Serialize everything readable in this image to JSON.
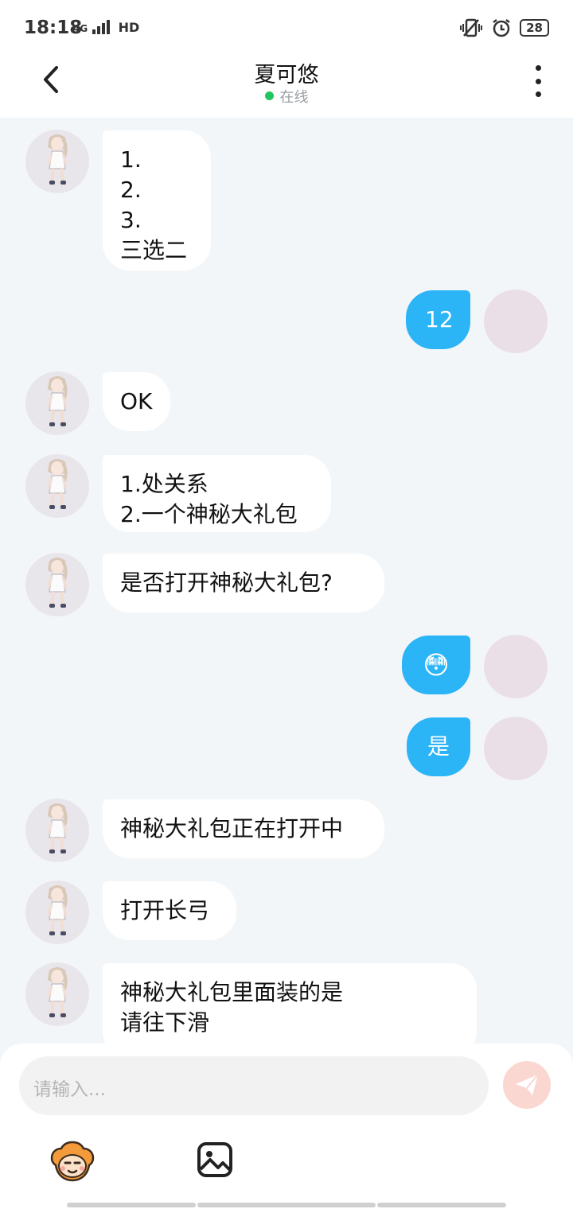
{
  "status_bar": {
    "time": "18:18",
    "network": "4G",
    "hd": "HD",
    "battery": "28"
  },
  "header": {
    "title": "夏可悠",
    "presence": "在线"
  },
  "messages": [
    {
      "side": "in",
      "text": "1.\n2.\n3.\n三选二"
    },
    {
      "side": "out",
      "text": "12"
    },
    {
      "side": "in",
      "text": "OK"
    },
    {
      "side": "in",
      "text": "1.处关系\n2.一个神秘大礼包"
    },
    {
      "side": "in",
      "text": "是否打开神秘大礼包?"
    },
    {
      "side": "out",
      "text": "😳"
    },
    {
      "side": "out",
      "text": "是"
    },
    {
      "side": "in",
      "text": "神秘大礼包正在打开中"
    },
    {
      "side": "in",
      "text": "打开长弓"
    },
    {
      "side": "in",
      "text": "神秘大礼包里面装的是\n请往下滑"
    }
  ],
  "composer": {
    "placeholder": "请输入..."
  },
  "icons": {
    "back": "chevron-left-icon",
    "menu": "more-vertical-icon",
    "send": "paper-plane-icon",
    "emoji": "emoji-sticker-icon",
    "image": "image-icon"
  },
  "colors": {
    "outgoing_bubble": "#2bb4f6",
    "online_dot": "#22c55e",
    "send_button": "#fbd7d2"
  }
}
